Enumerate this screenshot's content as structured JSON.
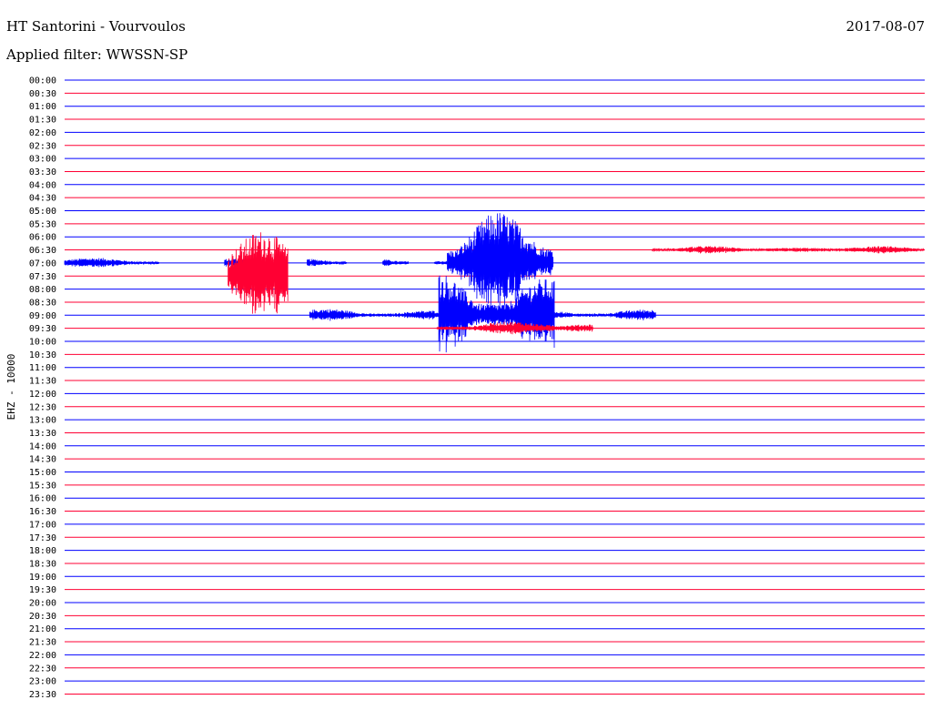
{
  "header": {
    "title": "HT Santorini - Vourvoulos",
    "date": "2017-08-07",
    "filter": "Applied filter: WWSSN-SP"
  },
  "chart_data": {
    "type": "line",
    "ylabel": "EHZ - 10000",
    "row_labels": [
      "00:00",
      "00:30",
      "01:00",
      "01:30",
      "02:00",
      "02:30",
      "03:00",
      "03:30",
      "04:00",
      "04:30",
      "05:00",
      "05:30",
      "06:00",
      "06:30",
      "07:00",
      "07:30",
      "08:00",
      "08:30",
      "09:00",
      "09:30",
      "10:00",
      "10:30",
      "11:00",
      "11:30",
      "12:00",
      "12:30",
      "13:00",
      "13:30",
      "14:00",
      "14:30",
      "15:00",
      "15:30",
      "16:00",
      "16:30",
      "17:00",
      "17:30",
      "18:00",
      "18:30",
      "19:00",
      "19:30",
      "20:00",
      "20:30",
      "21:00",
      "21:30",
      "22:00",
      "22:30",
      "23:00",
      "23:30"
    ],
    "row_colors": [
      "#0000ff",
      "#ff0033"
    ],
    "x_range_minutes": [
      0,
      30
    ],
    "segments": [
      {
        "row": 14,
        "x_start": 0.0,
        "x_end": 11.0,
        "amp": 0.4,
        "color": "#0000ff"
      },
      {
        "row": 14,
        "x_start": 18.6,
        "x_end": 23.0,
        "amp": 0.35,
        "color": "#0000ff"
      },
      {
        "row": 14,
        "x_start": 28.2,
        "x_end": 32.8,
        "amp": 0.35,
        "color": "#0000ff"
      },
      {
        "row": 14,
        "x_start": 37.0,
        "x_end": 40.0,
        "amp": 0.5,
        "color": "#0000ff"
      },
      {
        "row": 14,
        "x_start": 43.0,
        "x_end": 44.5,
        "amp": 0.6,
        "color": "#0000ff"
      },
      {
        "row": 14,
        "x_start": 44.5,
        "x_end": 56.8,
        "amp": 4.0,
        "color": "#0000ff"
      },
      {
        "row": 15,
        "x_start": 19.0,
        "x_end": 26.0,
        "amp": 3.5,
        "color": "#ff0033"
      },
      {
        "row": 18,
        "x_start": 28.5,
        "x_end": 43.5,
        "amp": 0.5,
        "color": "#0000ff"
      },
      {
        "row": 18,
        "x_start": 43.5,
        "x_end": 57.0,
        "amp": 3.5,
        "color": "#0000ff"
      },
      {
        "row": 18,
        "x_start": 57.0,
        "x_end": 68.8,
        "amp": 0.5,
        "color": "#0000ff"
      },
      {
        "row": 19,
        "x_start": 43.3,
        "x_end": 61.4,
        "amp": 0.55,
        "color": "#ff0033"
      },
      {
        "row": 13,
        "x_start": 68.3,
        "x_end": 100.0,
        "amp": 0.3,
        "color": "#ff0033"
      }
    ]
  }
}
